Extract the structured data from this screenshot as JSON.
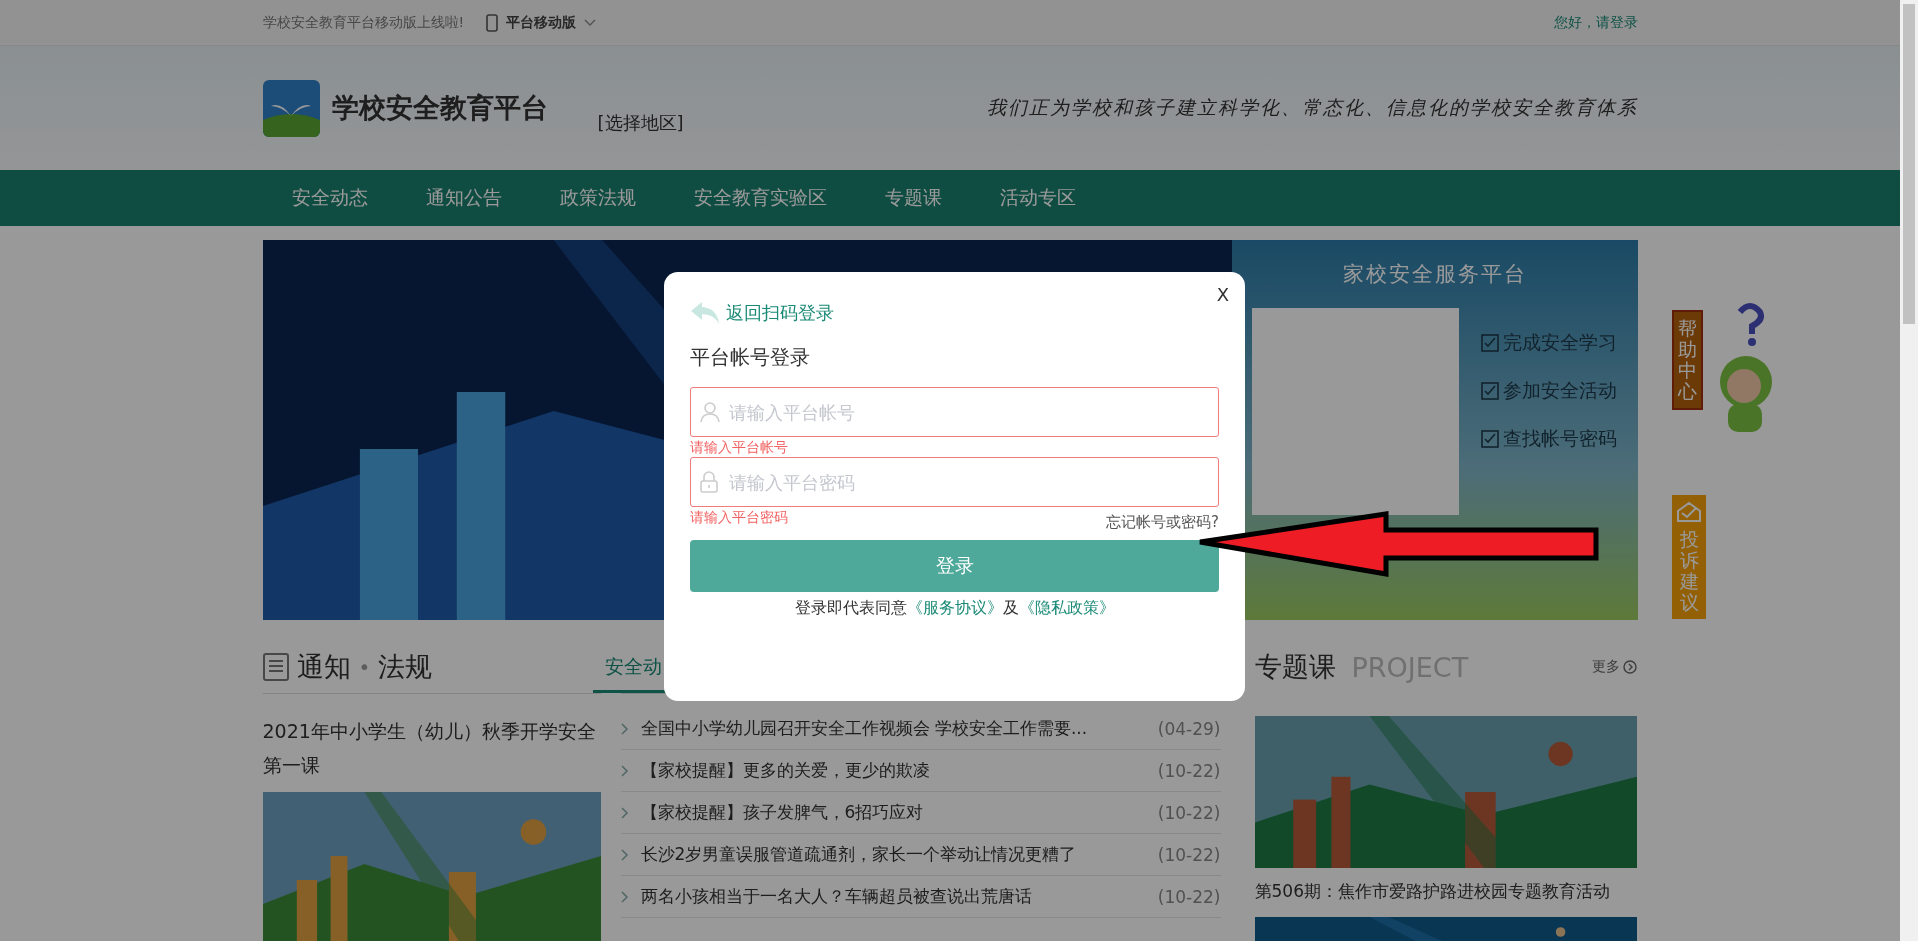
{
  "top_bar": {
    "notice": "学校安全教育平台移动版上线啦!",
    "mobile_label": "平台移动版",
    "login_link": "您好，请登录"
  },
  "header": {
    "logo_text": "学校安全教育平台",
    "region": "[选择地区]",
    "slogan": "我们正为学校和孩子建立科学化、常态化、信息化的学校安全教育体系"
  },
  "nav": [
    {
      "label": "安全动态"
    },
    {
      "label": "通知公告"
    },
    {
      "label": "政策法规"
    },
    {
      "label": "安全教育实验区"
    },
    {
      "label": "专题课"
    },
    {
      "label": "活动专区"
    }
  ],
  "service_panel": {
    "title": "家校安全服务平台",
    "items": [
      "完成安全学习",
      "参加安全活动",
      "查找帐号密码"
    ]
  },
  "side_widgets": [
    {
      "kind": "help",
      "label": "帮助中心"
    },
    {
      "kind": "complaint",
      "label": "投诉建议"
    }
  ],
  "notices": {
    "title_main": "通知",
    "title_dot": "•",
    "title_sub": "法规",
    "tabs": [
      {
        "label": "安全动",
        "selected": true
      }
    ],
    "feature_title": "2021年中小学生（幼儿）秋季开学安全第一课",
    "news": [
      {
        "title": "全国中小学幼儿园召开安全工作视频会 学校安全工作需要...",
        "date": "(04-29)"
      },
      {
        "title": "【家校提醒】更多的关爱，更少的欺凌",
        "date": "(10-22)"
      },
      {
        "title": "【家校提醒】孩子发脾气，6招巧应对",
        "date": "(10-22)"
      },
      {
        "title": "长沙2岁男童误服管道疏通剂，家长一个举动让情况更糟了",
        "date": "(10-22)"
      },
      {
        "title": "两名小孩相当于一名大人？车辆超员被查说出荒唐话",
        "date": "(10-22)"
      }
    ]
  },
  "project": {
    "title": "专题课",
    "subtitle": "PROJECT",
    "more": "更多",
    "caption": "第506期：焦作市爱路护路进校园专题教育活动"
  },
  "modal": {
    "close": "X",
    "back": "返回扫码登录",
    "title": "平台帐号登录",
    "fields": [
      {
        "kind": "account",
        "placeholder": "请输入平台帐号",
        "error": "请输入平台帐号"
      },
      {
        "kind": "password",
        "placeholder": "请输入平台密码",
        "error": "请输入平台密码"
      }
    ],
    "forgot": "忘记帐号或密码?",
    "submit": "登录",
    "agreement": {
      "prefix": "登录即代表同意",
      "terms": "《服务协议》",
      "joiner": "及",
      "privacy": "《隐私政策》"
    }
  }
}
